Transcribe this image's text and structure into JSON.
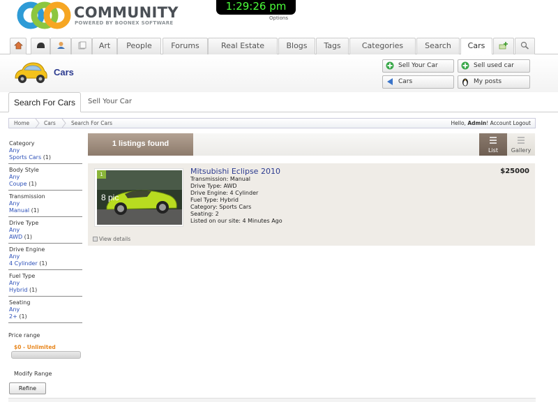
{
  "header": {
    "logo_title": "COMMUNITY",
    "logo_subtitle": "POWERED BY BOONEX SOFTWARE",
    "clock": "1:29:26 pm",
    "clock_options": "Options"
  },
  "nav": {
    "tabs": [
      {
        "label": "Art"
      },
      {
        "label": "People"
      },
      {
        "label": "Forums"
      },
      {
        "label": "Real Estate"
      },
      {
        "label": "Blogs"
      },
      {
        "label": "Tags"
      },
      {
        "label": "Categories"
      },
      {
        "label": "Search"
      },
      {
        "label": "Cars"
      }
    ],
    "icons": [
      "home-icon",
      "helmet-icon",
      "user-icon",
      "pages-icon",
      "add-member-icon",
      "search-icon"
    ]
  },
  "page": {
    "title": "Cars",
    "actions": [
      {
        "label": "Sell Your Car",
        "icon": "add-icon"
      },
      {
        "label": "Sell used car",
        "icon": "add-icon"
      },
      {
        "label": "Cars",
        "icon": "back-arrow-icon"
      },
      {
        "label": "My posts",
        "icon": "penguin-icon"
      }
    ]
  },
  "subtabs": {
    "active": "Search For Cars",
    "other": "Sell Your Car"
  },
  "breadcrumb": {
    "items": [
      "Home",
      "Cars",
      "Search For Cars"
    ],
    "hello": "Hello,",
    "user": "Admin",
    "account": "Account",
    "logout": "Logout"
  },
  "filters": [
    {
      "label": "Category",
      "any": "Any",
      "value": "Sports Cars",
      "count": "(1)"
    },
    {
      "label": "Body Style",
      "any": "Any",
      "value": "Coupe",
      "count": "(1)"
    },
    {
      "label": "Transmission",
      "any": "Any",
      "value": "Manual",
      "count": "(1)"
    },
    {
      "label": "Drive Type",
      "any": "Any",
      "value": "AWD",
      "count": "(1)"
    },
    {
      "label": "Drive Engine",
      "any": "Any",
      "value": "4 Cylinder",
      "count": "(1)"
    },
    {
      "label": "Fuel Type",
      "any": "Any",
      "value": "Hybrid",
      "count": "(1)"
    },
    {
      "label": "Seating",
      "any": "Any",
      "value": "2+",
      "count": "(1)"
    }
  ],
  "price": {
    "label": "Price range",
    "range": "$0 - Unlimited",
    "modify": "Modify Range",
    "refine": "Refine"
  },
  "results": {
    "found": "1 listings found",
    "view_list": "List",
    "view_gallery": "Gallery"
  },
  "listing": {
    "badge": "1",
    "pics": "8 pic",
    "title": "Mitsubishi Eclipse 2010",
    "price": "$25000",
    "details": [
      "Transmission: Manual",
      "Drive Type: AWD",
      "Drive Engine: 4 Cylinder",
      "Fuel Type: Hybrid",
      "Category: Sports Cars",
      "Seating: 2",
      "Listed on our site: 4 Minutes Ago"
    ],
    "view_details": "View details"
  },
  "colors": {
    "brand_blue": "#2b3a8f",
    "link": "#2b4fb8",
    "clock_green": "#4cff3a",
    "accent_orange": "#e8871e"
  }
}
